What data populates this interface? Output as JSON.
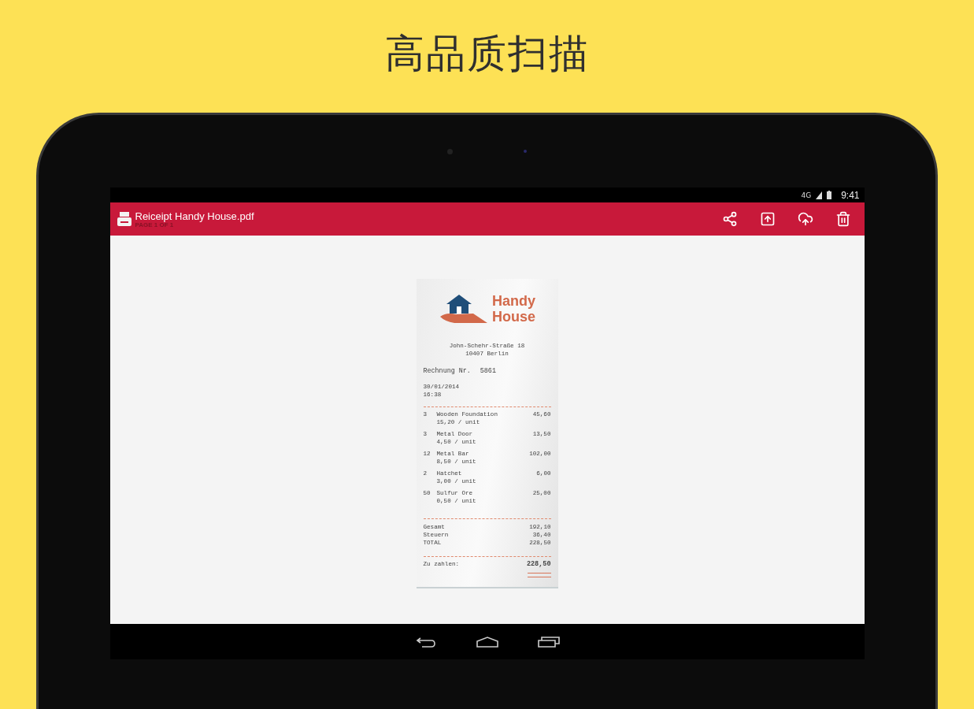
{
  "headline": "高品质扫描",
  "status_bar": {
    "network": "4G",
    "time": "9:41"
  },
  "toolbar": {
    "title": "Reiceipt Handy House.pdf",
    "subtitle": "PAGE 1 OF 1",
    "actions": [
      {
        "kind": "share"
      },
      {
        "kind": "export"
      },
      {
        "kind": "upload"
      },
      {
        "kind": "delete"
      }
    ]
  },
  "receipt": {
    "brand": [
      "Handy",
      "House"
    ],
    "address": [
      "John-Schehr-Straße 18",
      "10407 Berlin"
    ],
    "invoice_label": "Rechnung Nr.",
    "invoice_number": "5861",
    "date": "30/01/2014",
    "time": "16:38",
    "items": [
      {
        "qty": "3",
        "name": "Wooden Foundation",
        "unit_price": "15,20 / unit",
        "amount": "45,60"
      },
      {
        "qty": "3",
        "name": "Metal Door",
        "unit_price": "4,50 / unit",
        "amount": "13,50"
      },
      {
        "qty": "12",
        "name": "Metal Bar",
        "unit_price": "8,50 / unit",
        "amount": "102,00"
      },
      {
        "qty": "2",
        "name": "Hatchet",
        "unit_price": "3,00 / unit",
        "amount": "6,00"
      },
      {
        "qty": "50",
        "name": "Sulfur Ore",
        "unit_price": "0,50 / unit",
        "amount": "25,00"
      }
    ],
    "totals": [
      {
        "label": "Gesamt",
        "value": "192,10"
      },
      {
        "label": "Steuern",
        "value": "36,40"
      },
      {
        "label": "TOTAL",
        "value": "228,50"
      }
    ],
    "due": {
      "label": "Zu zahlen:",
      "value": "228,50"
    }
  },
  "nav_buttons": [
    {
      "kind": "back"
    },
    {
      "kind": "home"
    },
    {
      "kind": "recents"
    }
  ]
}
